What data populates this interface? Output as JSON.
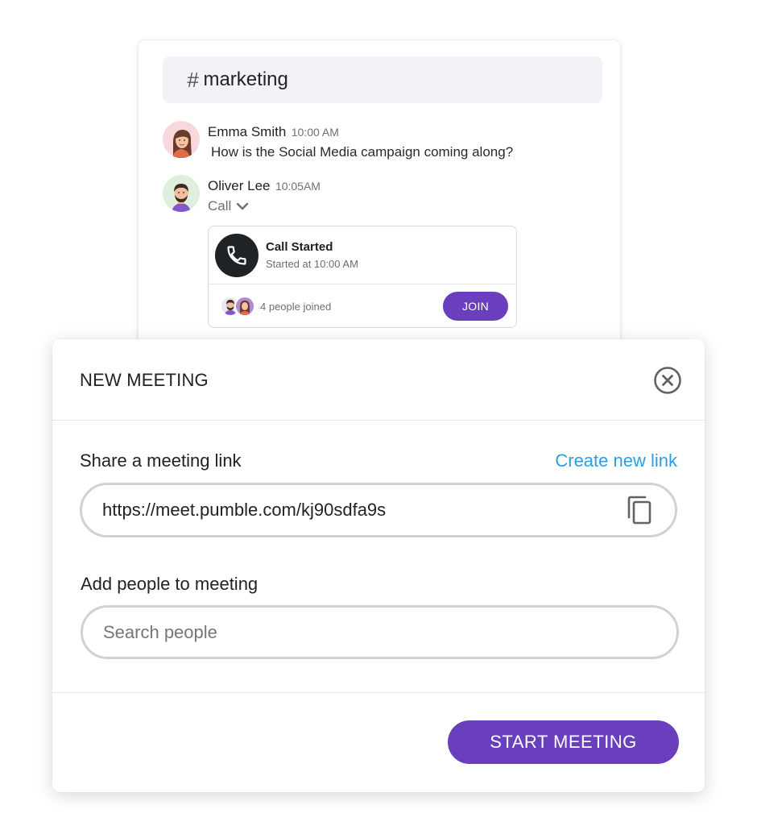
{
  "channel": {
    "hash": "#",
    "name": "marketing"
  },
  "messages": [
    {
      "author": "Emma Smith",
      "time": "10:00 AM",
      "text": "How is the Social Media campaign coming along?"
    },
    {
      "author": "Oliver Lee",
      "time": "10:05AM",
      "call_label": "Call"
    }
  ],
  "call_card": {
    "title": "Call Started",
    "subtitle": "Started at 10:00 AM",
    "people_joined": "4 people joined",
    "join_label": "JOIN"
  },
  "modal": {
    "title": "NEW MEETING",
    "share_label": "Share a meeting link",
    "create_link_label": "Create new link",
    "link_value": "https://meet.pumble.com/kj90sdfa9s",
    "add_people_label": "Add people to meeting",
    "search_placeholder": "Search people",
    "start_label": "START MEETING"
  },
  "icons": {
    "close": "close-circle-icon",
    "copy": "copy-icon",
    "phone": "phone-icon",
    "chevron": "chevron-down-icon"
  },
  "colors": {
    "accent_purple": "#6a3fbd",
    "link_blue": "#2a9ee8",
    "phone_dark": "#1f2326"
  }
}
